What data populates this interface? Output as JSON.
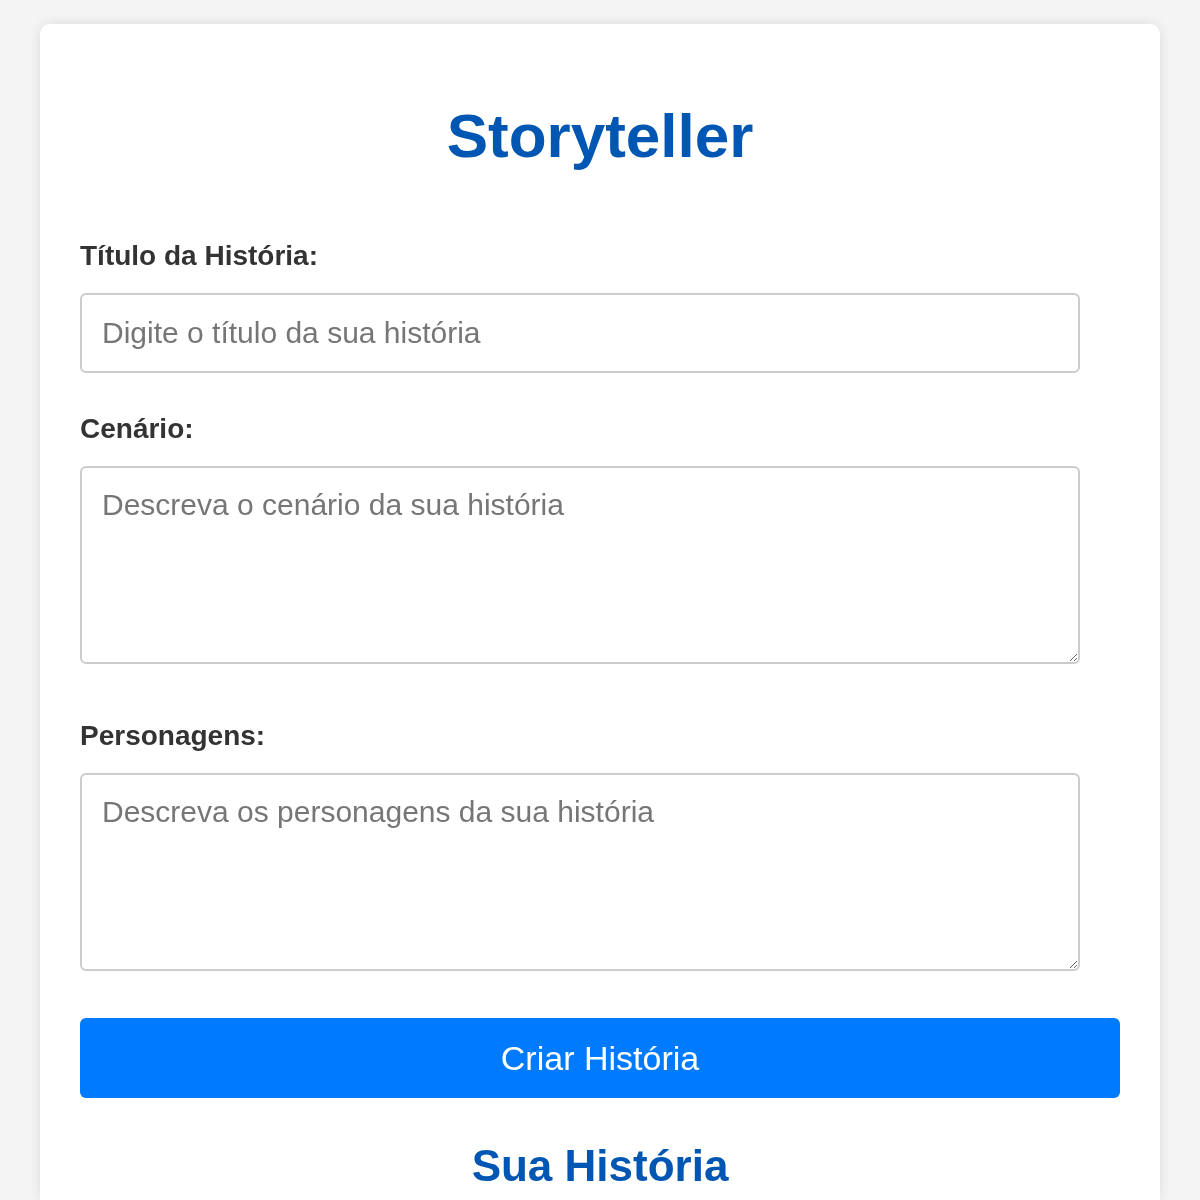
{
  "title": "Storyteller",
  "fields": [
    {
      "kind": "input",
      "label": "Título da História:",
      "placeholder": "Digite o título da sua história"
    },
    {
      "kind": "textarea",
      "label": "Cenário:",
      "placeholder": "Descreva o cenário da sua história"
    },
    {
      "kind": "textarea",
      "label": "Personagens:",
      "placeholder": "Descreva os personagens da sua história"
    }
  ],
  "submit_button": "Criar História",
  "result": {
    "heading": "Sua História"
  }
}
